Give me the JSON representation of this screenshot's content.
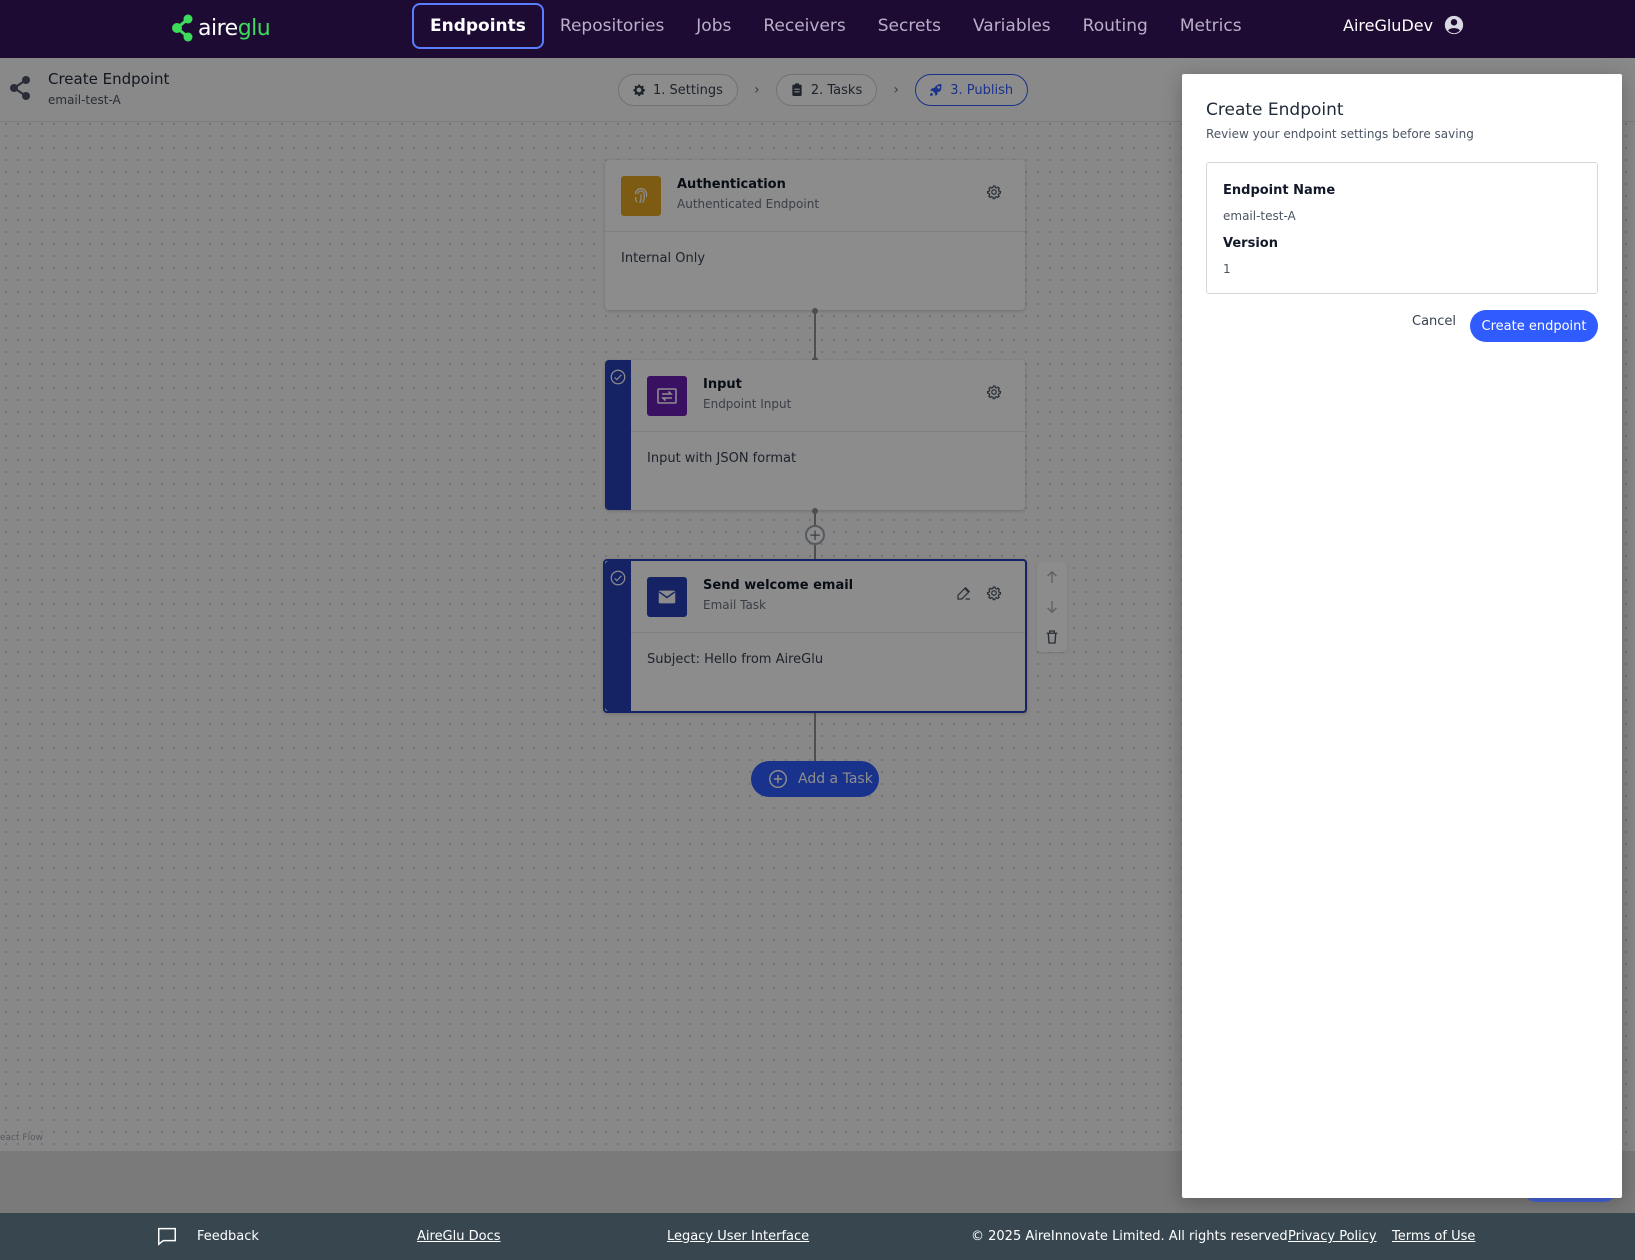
{
  "brand": {
    "name_part1": "aire",
    "name_part2": "glu",
    "green": "#3ddc5a",
    "nav_bg": "#1e0b33",
    "accent": "#2f5bff"
  },
  "nav": {
    "tabs": [
      {
        "label": "Endpoints",
        "active": true
      },
      {
        "label": "Repositories"
      },
      {
        "label": "Jobs"
      },
      {
        "label": "Receivers"
      },
      {
        "label": "Secrets"
      },
      {
        "label": "Variables"
      },
      {
        "label": "Routing"
      },
      {
        "label": "Metrics"
      }
    ],
    "user": "AireGluDev"
  },
  "header": {
    "title": "Create Endpoint",
    "subtitle": "email-test-A"
  },
  "steps": [
    {
      "label": "1. Settings",
      "icon": "gear-icon"
    },
    {
      "label": "2. Tasks",
      "icon": "clipboard-icon"
    },
    {
      "label": "3. Publish",
      "icon": "rocket-icon",
      "active": true
    }
  ],
  "nodes": {
    "auth": {
      "title": "Authentication",
      "subtitle": "Authenticated Endpoint",
      "body": "Internal Only",
      "icon": "fingerprint-icon",
      "color": "#e3a623"
    },
    "input": {
      "title": "Input",
      "subtitle": "Endpoint Input",
      "body": "Input with JSON format",
      "icon": "input-icon",
      "color": "#6b1fb3"
    },
    "email": {
      "title": "Send welcome email",
      "subtitle": "Email Task",
      "body": "Subject: Hello from AireGlu",
      "icon": "mail-icon",
      "color": "#2740b8"
    }
  },
  "add_task_label": "Add a Task",
  "reactflow_attr": "eact Flow",
  "drawer": {
    "title": "Create Endpoint",
    "subtitle": "Review your endpoint settings before saving",
    "fields": [
      {
        "label": "Endpoint Name",
        "value": "email-test-A"
      },
      {
        "label": "Version",
        "value": "1"
      }
    ],
    "cancel": "Cancel",
    "confirm": "Create endpoint"
  },
  "footer": {
    "feedback": "Feedback",
    "docs": "AireGlu Docs",
    "legacy": "Legacy User Interface",
    "copyright": "© 2025 AireInnovate Limited. All rights reserved",
    "privacy": "Privacy Policy",
    "terms": "Terms of Use"
  }
}
